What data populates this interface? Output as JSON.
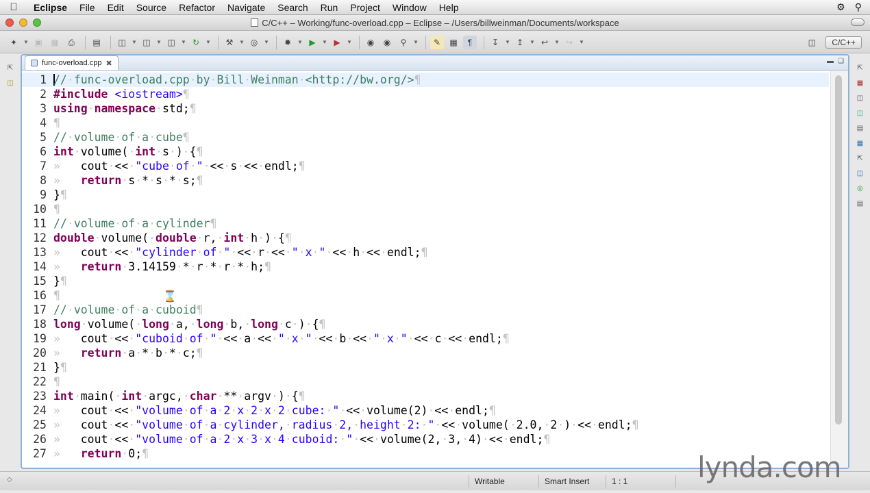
{
  "menubar": {
    "app": "Eclipse",
    "items": [
      "File",
      "Edit",
      "Source",
      "Refactor",
      "Navigate",
      "Search",
      "Run",
      "Project",
      "Window",
      "Help"
    ]
  },
  "window": {
    "title": "C/C++ – Working/func-overload.cpp – Eclipse – /Users/billweinman/Documents/workspace"
  },
  "perspective": {
    "label": "C/C++"
  },
  "editor": {
    "tab_label": "func-overload.cpp",
    "current_line": 1,
    "lines": [
      {
        "n": "1",
        "text": "// func-overload.cpp by Bill Weinman <http://bw.org/>"
      },
      {
        "n": "2",
        "text": "#include <iostream>"
      },
      {
        "n": "3",
        "text": "using namespace std;"
      },
      {
        "n": "4",
        "text": ""
      },
      {
        "n": "5",
        "text": "// volume of a cube"
      },
      {
        "n": "6",
        "text": "int volume( int s ) {"
      },
      {
        "n": "7",
        "text": "    cout << \"cube of \" << s << endl;"
      },
      {
        "n": "8",
        "text": "    return s * s * s;"
      },
      {
        "n": "9",
        "text": "}"
      },
      {
        "n": "10",
        "text": ""
      },
      {
        "n": "11",
        "text": "// volume of a cylinder"
      },
      {
        "n": "12",
        "text": "double volume( double r, int h ) {"
      },
      {
        "n": "13",
        "text": "    cout << \"cylinder of \" << r << \" x \" << h << endl;"
      },
      {
        "n": "14",
        "text": "    return 3.14159 * r * r * h;"
      },
      {
        "n": "15",
        "text": "}"
      },
      {
        "n": "16",
        "text": ""
      },
      {
        "n": "17",
        "text": "// volume of a cuboid"
      },
      {
        "n": "18",
        "text": "long volume( long a, long b, long c ) {"
      },
      {
        "n": "19",
        "text": "    cout << \"cuboid of \" << a << \" x \" << b << \" x \" << c << endl;"
      },
      {
        "n": "20",
        "text": "    return a * b * c;"
      },
      {
        "n": "21",
        "text": "}"
      },
      {
        "n": "22",
        "text": ""
      },
      {
        "n": "23",
        "text": "int main( int argc, char ** argv ) {"
      },
      {
        "n": "24",
        "text": "    cout << \"volume of a 2 x 2 x 2 cube: \" << volume(2) << endl;"
      },
      {
        "n": "25",
        "text": "    cout << \"volume of a cylinder, radius 2, height 2: \" << volume( 2.0, 2 ) << endl;"
      },
      {
        "n": "26",
        "text": "    cout << \"volume of a 2 x 3 x 4 cuboid: \" << volume(2, 3, 4) << endl;"
      },
      {
        "n": "27",
        "text": "    return 0;"
      }
    ]
  },
  "statusbar": {
    "writable": "Writable",
    "insert_mode": "Smart Insert",
    "position": "1 : 1"
  },
  "watermark": {
    "text": "lynda.com"
  },
  "colors": {
    "keyword": "#7f0055",
    "string": "#2a00ff",
    "comment": "#3f7f5f",
    "editor_border": "#8fb1d6"
  }
}
